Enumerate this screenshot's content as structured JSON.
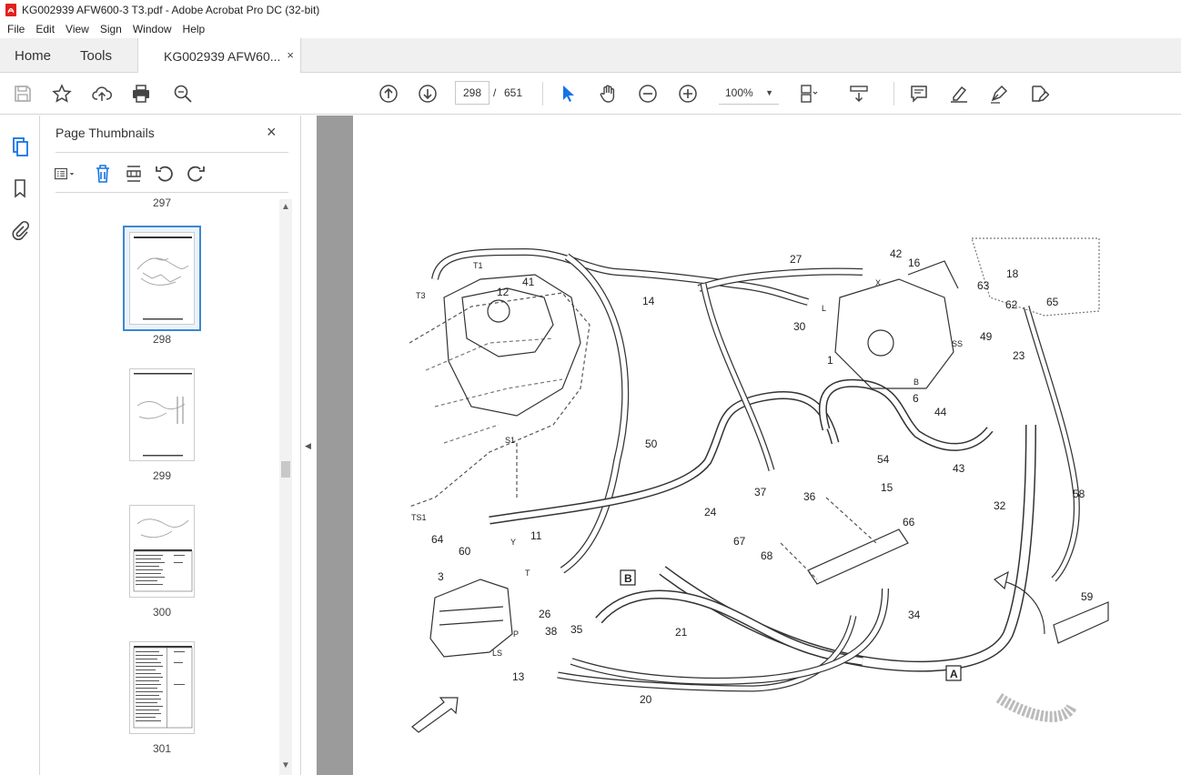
{
  "window": {
    "title": "KG002939 AFW600-3 T3.pdf - Adobe Acrobat Pro DC (32-bit)"
  },
  "menu": [
    "File",
    "Edit",
    "View",
    "Sign",
    "Window",
    "Help"
  ],
  "tabs": {
    "home": "Home",
    "tools": "Tools",
    "document": "KG002939 AFW60...",
    "close": "×"
  },
  "toolbar": {
    "current_page": "298",
    "page_separator": "/",
    "total_pages": "651",
    "zoom": "100%",
    "zoom_caret": "▼"
  },
  "thumbnails": {
    "title": "Page Thumbnails",
    "close": "×",
    "pages": [
      "297",
      "298",
      "299",
      "300",
      "301"
    ],
    "selected": "298"
  },
  "collapse_arrow": "◀",
  "diagram": {
    "callouts": [
      "12",
      "41",
      "27",
      "42",
      "16",
      "18",
      "63",
      "65",
      "62",
      "14",
      "30",
      "49",
      "23",
      "1",
      "6",
      "44",
      "43",
      "50",
      "54",
      "37",
      "36",
      "15",
      "24",
      "32",
      "58",
      "66",
      "67",
      "68",
      "11",
      "3",
      "26",
      "35",
      "21",
      "34",
      "59",
      "38",
      "13",
      "20",
      "64",
      "60"
    ],
    "port_labels": [
      "T1",
      "T3",
      "L",
      "X",
      "SS",
      "B",
      "S1",
      "TS1",
      "Y",
      "T",
      "P",
      "LS"
    ],
    "view_labels": [
      "A",
      "B"
    ]
  }
}
